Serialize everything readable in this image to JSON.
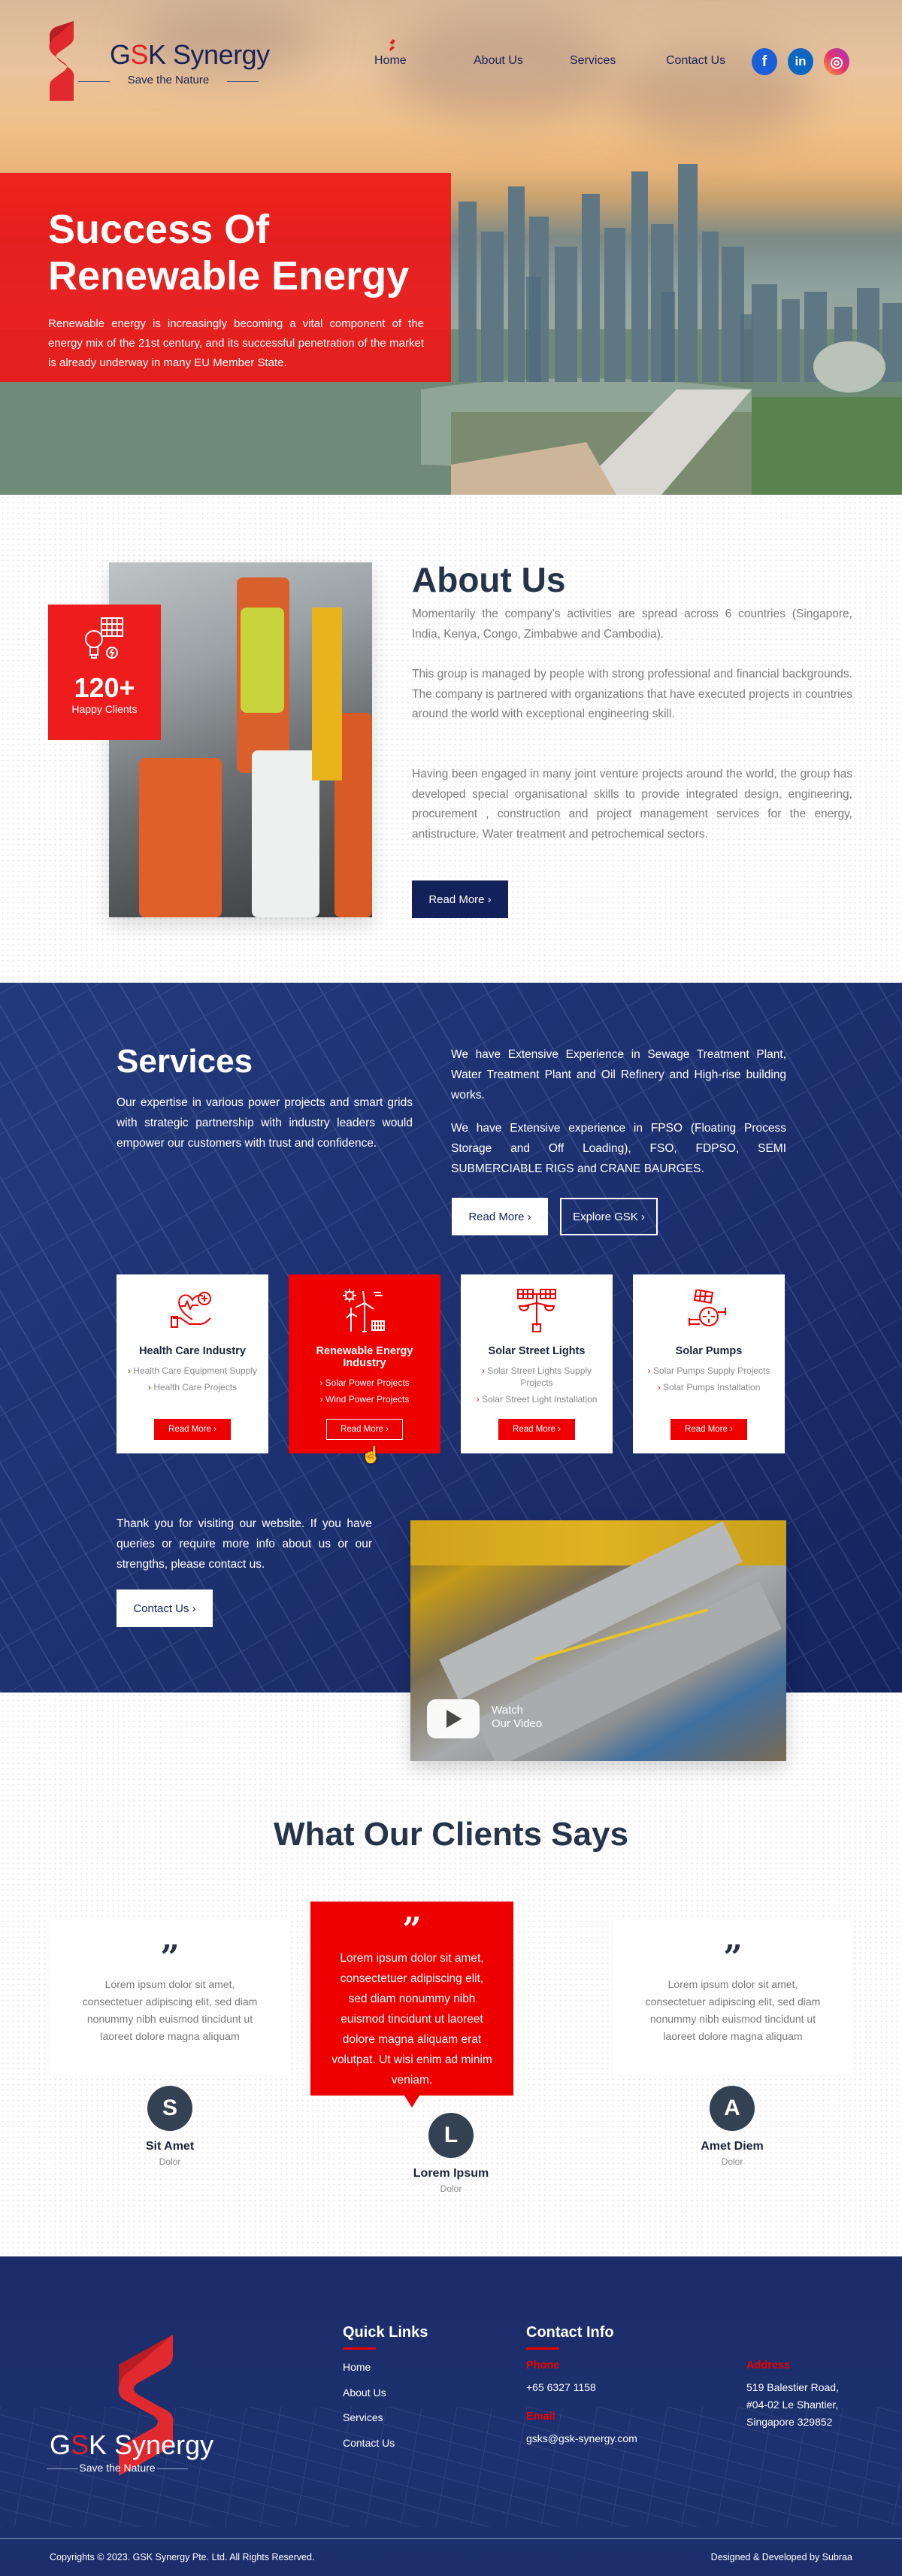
{
  "header": {
    "brand_prefix": "G",
    "brand_accent": "S",
    "brand_suffix": "K Synergy",
    "tagline": "Save the Nature",
    "nav": [
      {
        "label": "Home",
        "active": true
      },
      {
        "label": "About Us",
        "active": false
      },
      {
        "label": "Services",
        "active": false
      },
      {
        "label": "Contact Us",
        "active": false
      }
    ],
    "social": [
      {
        "icon": "facebook-icon",
        "glyph": "f"
      },
      {
        "icon": "linkedin-icon",
        "glyph": "in"
      },
      {
        "icon": "instagram-icon",
        "glyph": "◎"
      }
    ]
  },
  "hero": {
    "title_line1": "Success Of",
    "title_line2": "Renewable Energy",
    "text": "Renewable energy is increasingly becoming a vital component of the energy mix of the 21st century, and its successful penetration of the market is already underway in many EU Member State."
  },
  "about": {
    "badge_number": "120+",
    "badge_label": "Happy Clients",
    "title": "About Us",
    "paragraphs": [
      "Momentarily the company’s activities are spread across 6 countries (Singapore, India, Kenya, Congo, Zimbabwe and Cambodia).",
      "This group is managed by people with strong professional and financial backgrounds. The company is partnered with organizations that have executed projects in countries around the world with exceptional engineering skill.",
      "Having been engaged in many joint venture projects around the world, the group has developed special organisational skills to provide integrated design, engineering, procurement , construction and project management services for the energy, antistructure. Water treatment and petrochemical sectors."
    ],
    "button": "Read More ›"
  },
  "services": {
    "title": "Services",
    "lead": "Our expertise in various power projects and smart grids with strategic partnership with industry leaders would empower our customers with trust and confidence.",
    "right_paragraphs": [
      "We have Extensive Experience in Sewage Treatment Plant, Water Treatment Plant and Oil Refinery and High-rise building works.",
      "We have Extensive experience in FPSO (Floating Process Storage and Off Loading), FSO, FDPSO, SEMI SUBMERCIABLE RIGS and CRANE BAURGES."
    ],
    "read_more": "Read More ›",
    "explore": "Explore GSK ›",
    "cards": [
      {
        "title": "Health Care Industry",
        "icon": "healthcare-hand-heart-icon",
        "items": [
          "Health Care Equipment Supply",
          "Health Care Projects"
        ],
        "button": "Read More ›",
        "active": false
      },
      {
        "title": "Renewable Energy Industry",
        "icon": "wind-solar-energy-icon",
        "items": [
          "Solar Power Projects",
          "Wind Power Projects"
        ],
        "button": "Read More ›",
        "active": true
      },
      {
        "title": "Solar Street Lights",
        "icon": "solar-street-light-icon",
        "items": [
          "Solar Street Lights Supply Projects",
          "Solar Street Light Installation"
        ],
        "button": "Read More ›",
        "active": false
      },
      {
        "title": "Solar Pumps",
        "icon": "solar-pump-icon",
        "items": [
          "Solar Pumps Supply Projects",
          "Solar Pumps Installation"
        ],
        "button": "Read More ›",
        "active": false
      }
    ],
    "contact_text": "Thank you for visiting our website. If you have queries or require more info about us or our strengths, please contact us.",
    "contact_button": "Contact Us ›",
    "video_label_1": "Watch",
    "video_label_2": "Our Video"
  },
  "testimonials": {
    "title": "What Our Clients Says",
    "quote_mark": "”",
    "items": [
      {
        "text": "Lorem ipsum dolor sit amet, consectetuer adipiscing elit, sed diam nonummy nibh euismod tincidunt ut laoreet dolore magna aliquam",
        "initial": "S",
        "name": "Sit Amet",
        "role": "Dolor",
        "featured": false
      },
      {
        "text": "Lorem ipsum dolor sit amet, consectetuer adipiscing elit, sed diam nonummy nibh euismod tincidunt ut laoreet dolore magna aliquam erat volutpat. Ut wisi enim ad minim veniam.",
        "initial": "L",
        "name": "Lorem Ipsum",
        "role": "Dolor",
        "featured": true
      },
      {
        "text": "Lorem ipsum dolor sit amet, consectetuer adipiscing elit, sed diam nonummy nibh euismod tincidunt ut laoreet dolore magna aliquam",
        "initial": "A",
        "name": "Amet Diem",
        "role": "Dolor",
        "featured": false
      }
    ]
  },
  "footer": {
    "brand_prefix": "G",
    "brand_accent": "S",
    "brand_suffix": "K Synergy",
    "tagline": "Save the Nature",
    "quick_links_title": "Quick Links",
    "quick_links": [
      "Home",
      "About Us",
      "Services",
      "Contact Us"
    ],
    "contact_title": "Contact Info",
    "phone_label": "Phone",
    "phone": "+65 6327 1158",
    "email_label": "Email",
    "email": "gsks@gsk-synergy.com",
    "address_label": "Address",
    "address_lines": [
      "519 Balestier Road,",
      "#04-02 Le Shantier,",
      "Singapore 329852"
    ],
    "copyright": "Copyrights © 2023. GSK Synergy Pte. Ltd. All Rights Reserved.",
    "credit": "Designed & Developed by Subraa"
  },
  "colors": {
    "brand_red": "#ee0000",
    "brand_navy": "#12215a",
    "heading_dark": "#26344a"
  }
}
